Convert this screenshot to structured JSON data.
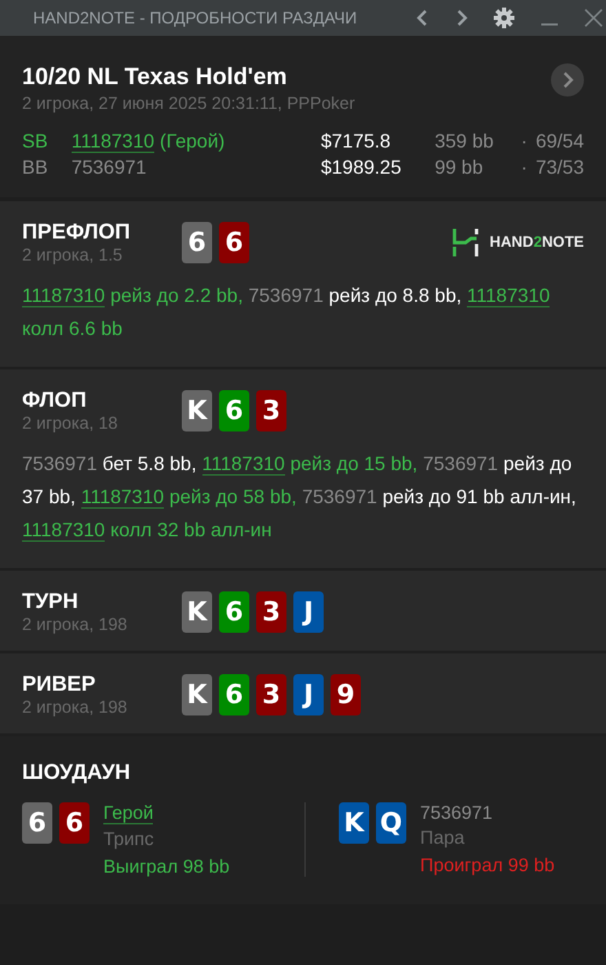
{
  "window": {
    "title": "HAND2NOTE - ПОДРОБНОСТИ РАЗДАЧИ"
  },
  "header": {
    "title": "10/20 NL Texas Hold'em",
    "subtitle": "2 игрока, 27 июня 2025 20:31:11, PPPoker",
    "players": [
      {
        "position": "SB",
        "name": "11187310",
        "hero": true,
        "suffix": "(Герой)",
        "stack": "$7175.8",
        "bb": "359 bb",
        "separator": "·",
        "stats": "69/54"
      },
      {
        "position": "BB",
        "name": "7536971",
        "hero": false,
        "stack": "$1989.25",
        "bb": "99 bb",
        "separator": "·",
        "stats": "73/53"
      }
    ]
  },
  "streets": [
    {
      "name": "ПРЕФЛОП",
      "subtitle": "2 игрока, 1.5",
      "logo": {
        "before": "HAND",
        "accent": "2",
        "after": "NOTE"
      },
      "cards": [
        {
          "rank": "6",
          "color": "#666666"
        },
        {
          "rank": "6",
          "color": "#8b0000"
        }
      ],
      "actions": [
        {
          "player": "11187310",
          "hero": true,
          "text": "рейз до 2.2 bb,"
        },
        {
          "player": "7536971",
          "hero": false,
          "text": "рейз до 8.8 bb,"
        },
        {
          "player": "11187310",
          "hero": true,
          "text": "колл 6.6 bb"
        }
      ]
    },
    {
      "name": "ФЛОП",
      "subtitle": "2 игрока, 18",
      "cards": [
        {
          "rank": "K",
          "color": "#666666"
        },
        {
          "rank": "6",
          "color": "#008c00"
        },
        {
          "rank": "3",
          "color": "#8b0000"
        }
      ],
      "actions": [
        {
          "player": "7536971",
          "hero": false,
          "text": "бет 5.8 bb,"
        },
        {
          "player": "11187310",
          "hero": true,
          "text": "рейз до 15 bb,"
        },
        {
          "player": "7536971",
          "hero": false,
          "text": "рейз до 37 bb,"
        },
        {
          "player": "11187310",
          "hero": true,
          "text": "рейз до 58 bb,"
        },
        {
          "player": "7536971",
          "hero": false,
          "text": "рейз до 91 bb алл-ин,"
        },
        {
          "player": "11187310",
          "hero": true,
          "text": "колл 32 bb алл-ин"
        }
      ]
    },
    {
      "name": "ТУРН",
      "subtitle": "2 игрока, 198",
      "cards": [
        {
          "rank": "K",
          "color": "#666666"
        },
        {
          "rank": "6",
          "color": "#008c00"
        },
        {
          "rank": "3",
          "color": "#8b0000"
        },
        {
          "rank": "J",
          "color": "#0055a5"
        }
      ]
    },
    {
      "name": "РИВЕР",
      "subtitle": "2 игрока, 198",
      "cards": [
        {
          "rank": "K",
          "color": "#666666"
        },
        {
          "rank": "6",
          "color": "#008c00"
        },
        {
          "rank": "3",
          "color": "#8b0000"
        },
        {
          "rank": "J",
          "color": "#0055a5"
        },
        {
          "rank": "9",
          "color": "#8b0000"
        }
      ]
    }
  ],
  "showdown": {
    "title": "ШОУДАУН",
    "hands": [
      {
        "name": "Герой",
        "hero": true,
        "hand": "Трипс",
        "result": "Выиграл 98 bb",
        "won": true,
        "cards": [
          {
            "rank": "6",
            "color": "#666666"
          },
          {
            "rank": "6",
            "color": "#8b0000"
          }
        ]
      },
      {
        "name": "7536971",
        "hero": false,
        "hand": "Пара",
        "result": "Проиграл 99 bb",
        "won": false,
        "cards": [
          {
            "rank": "K",
            "color": "#0055a5"
          },
          {
            "rank": "Q",
            "color": "#0055a5"
          }
        ]
      }
    ]
  }
}
